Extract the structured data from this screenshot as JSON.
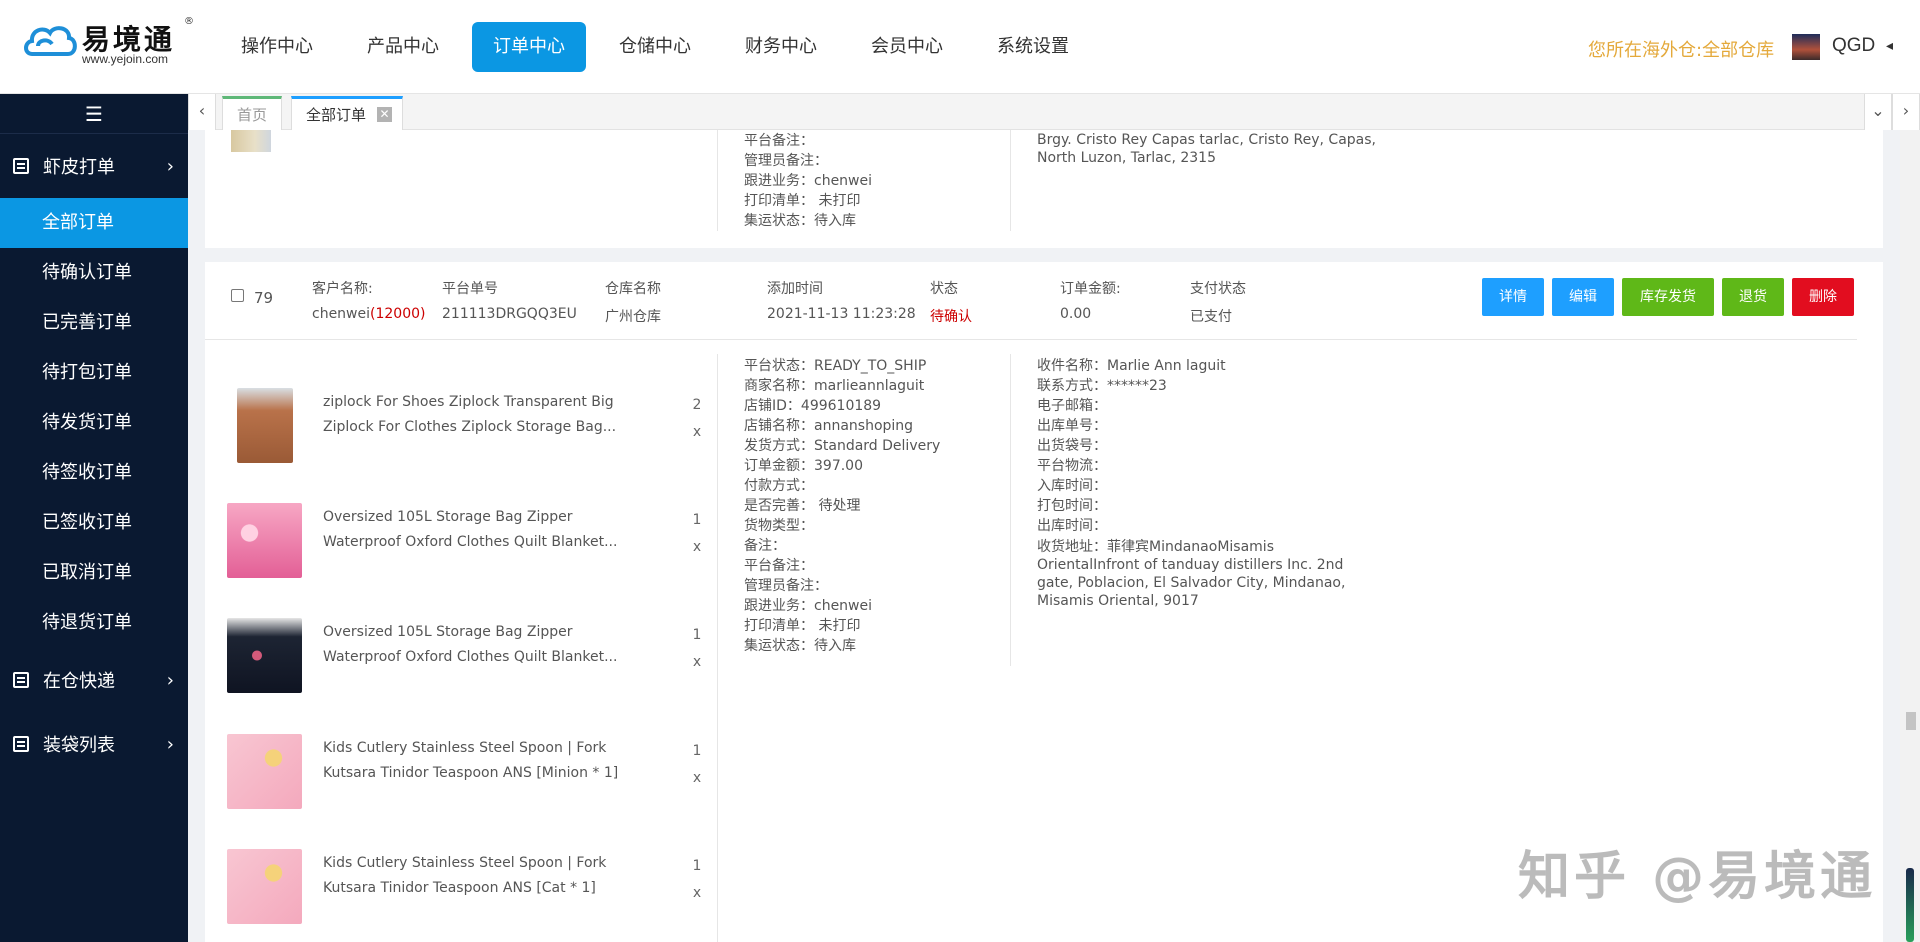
{
  "logo": {
    "name": "易境通",
    "url": "www.yejoin.com",
    "reg": "®"
  },
  "nav": {
    "items": [
      {
        "label": "操作中心"
      },
      {
        "label": "产品中心"
      },
      {
        "label": "订单中心",
        "active": true
      },
      {
        "label": "仓储中心"
      },
      {
        "label": "财务中心"
      },
      {
        "label": "会员中心"
      },
      {
        "label": "系统设置"
      }
    ]
  },
  "header": {
    "warehouse_info": "您所在海外仓:全部仓库",
    "user_name": "QGD",
    "user_caret": "◂"
  },
  "sidebar": {
    "toggle_icon": "☰",
    "group1": {
      "label": "虾皮打单",
      "arrow": "›"
    },
    "items": [
      {
        "label": "全部订单",
        "active": true
      },
      {
        "label": "待确认订单"
      },
      {
        "label": "已完善订单"
      },
      {
        "label": "待打包订单"
      },
      {
        "label": "待发货订单"
      },
      {
        "label": "待签收订单"
      },
      {
        "label": "已签收订单"
      },
      {
        "label": "已取消订单"
      },
      {
        "label": "待退货订单"
      }
    ],
    "group2": {
      "label": "在仓快递",
      "arrow": "›"
    },
    "group3": {
      "label": "装袋列表",
      "arrow": "›"
    }
  },
  "tabs": {
    "left_arrow": "‹",
    "home": "首页",
    "all_orders": "全部订单",
    "close": "✕",
    "dropdown": "⌄",
    "right_arrow": "›"
  },
  "prev_order": {
    "lines": [
      "平台备注：",
      "管理员备注：",
      "跟进业务：chenwei",
      "打印清单： 未打印",
      "集运状态：待入库"
    ],
    "address": "Brgy. Cristo Rey Capas tarlac, Cristo Rey, Capas, North Luzon, Tarlac, 2315"
  },
  "order": {
    "row_no": "79",
    "headers": {
      "customer": "客户名称:",
      "platform_no": "平台单号",
      "warehouse": "仓库名称",
      "added_time": "添加时间",
      "status": "状态",
      "amount": "订单金额:",
      "pay_status": "支付状态"
    },
    "values": {
      "customer": "chenwei",
      "customer_code": "(12000)",
      "platform_no": "211113DRGQQ3EU",
      "warehouse": "广州仓库",
      "added_time": "2021-11-13 11:23:28",
      "status": "待确认",
      "amount": "0.00",
      "pay_status": "已支付"
    },
    "buttons": {
      "detail": "详情",
      "edit": "编辑",
      "stock_ship": "库存发货",
      "return": "退货",
      "delete": "删除"
    },
    "info_lines": [
      "平台状态：READY_TO_SHIP",
      "商家名称：marlieannlaguit",
      "店铺ID：499610189",
      "店铺名称：annanshoping",
      "发货方式：Standard Delivery",
      "订单金额：397.00",
      "付款方式：",
      "是否完善： 待处理",
      "货物类型：",
      "备注：",
      "平台备注：",
      "管理员备注：",
      "跟进业务：chenwei",
      "打印清单： 未打印",
      "集运状态：待入库"
    ],
    "receiver_lines": [
      "收件名称：Marlie Ann laguit",
      "联系方式：******23",
      "电子邮箱：",
      "出库单号：",
      "出货袋号：",
      "平台物流：",
      "入库时间：",
      "打包时间：",
      "出库时间："
    ],
    "receiver_address": "收货地址：菲律宾MindanaoMisamis OrientalInfront of tanduay distillers Inc. 2nd gate, Poblacion, El Salvador City, Mindanao, Misamis Oriental, 9017",
    "products": [
      {
        "name": "ziplock For Shoes Ziplock Transparent Big Ziplock For Clothes Ziplock Storage Bag...",
        "qty": "2",
        "x": "x"
      },
      {
        "name": "Oversized 105L Storage Bag Zipper Waterproof Oxford Clothes Quilt Blanket...",
        "qty": "1",
        "x": "x"
      },
      {
        "name": "Oversized 105L Storage Bag Zipper Waterproof Oxford Clothes Quilt Blanket...",
        "qty": "1",
        "x": "x"
      },
      {
        "name": "Kids Cutlery Stainless Steel Spoon | Fork Kutsara Tinidor Teaspoon ANS [Minion * 1]",
        "qty": "1",
        "x": "x"
      },
      {
        "name": "Kids Cutlery Stainless Steel Spoon | Fork Kutsara Tinidor Teaspoon ANS [Cat * 1]",
        "qty": "1",
        "x": "x"
      }
    ]
  },
  "watermark": "知乎 @易境通"
}
